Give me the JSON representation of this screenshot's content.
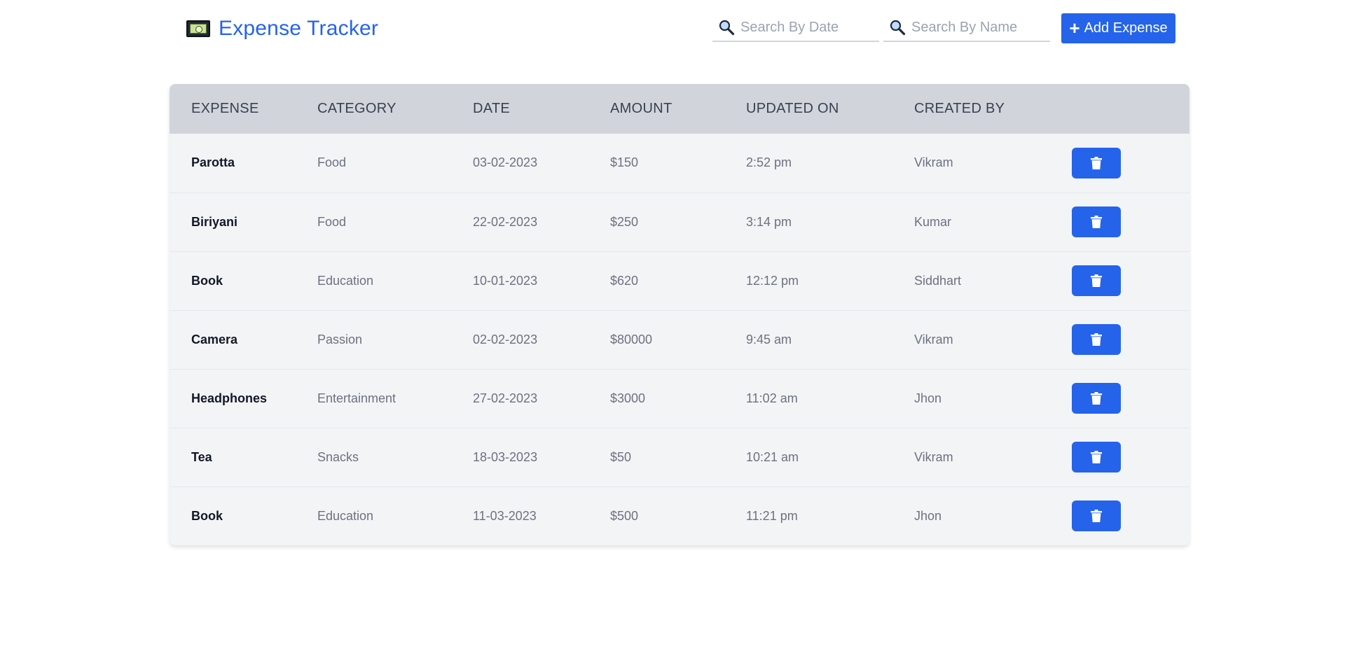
{
  "app": {
    "title": "Expense Tracker"
  },
  "search": {
    "date_placeholder": "Search By Date",
    "name_placeholder": "Search By Name"
  },
  "toolbar": {
    "add_label": "Add Expense"
  },
  "colors": {
    "accent": "#2563eb",
    "header_bg": "#d1d5db",
    "row_bg": "#f3f4f6"
  },
  "table": {
    "columns": [
      "EXPENSE",
      "CATEGORY",
      "DATE",
      "AMOUNT",
      "UPDATED ON",
      "CREATED BY"
    ],
    "rows": [
      {
        "expense": "Parotta",
        "category": "Food",
        "date": "03-02-2023",
        "amount": "$150",
        "updated": "2:52 pm",
        "created_by": "Vikram"
      },
      {
        "expense": "Biriyani",
        "category": "Food",
        "date": "22-02-2023",
        "amount": "$250",
        "updated": "3:14 pm",
        "created_by": "Kumar"
      },
      {
        "expense": "Book",
        "category": "Education",
        "date": "10-01-2023",
        "amount": "$620",
        "updated": "12:12 pm",
        "created_by": "Siddhart"
      },
      {
        "expense": "Camera",
        "category": "Passion",
        "date": "02-02-2023",
        "amount": "$80000",
        "updated": "9:45 am",
        "created_by": "Vikram"
      },
      {
        "expense": "Headphones",
        "category": "Entertainment",
        "date": "27-02-2023",
        "amount": "$3000",
        "updated": "11:02 am",
        "created_by": "Jhon"
      },
      {
        "expense": "Tea",
        "category": "Snacks",
        "date": "18-03-2023",
        "amount": "$50",
        "updated": "10:21 am",
        "created_by": "Vikram"
      },
      {
        "expense": "Book",
        "category": "Education",
        "date": "11-03-2023",
        "amount": "$500",
        "updated": "11:21 pm",
        "created_by": "Jhon"
      }
    ]
  }
}
